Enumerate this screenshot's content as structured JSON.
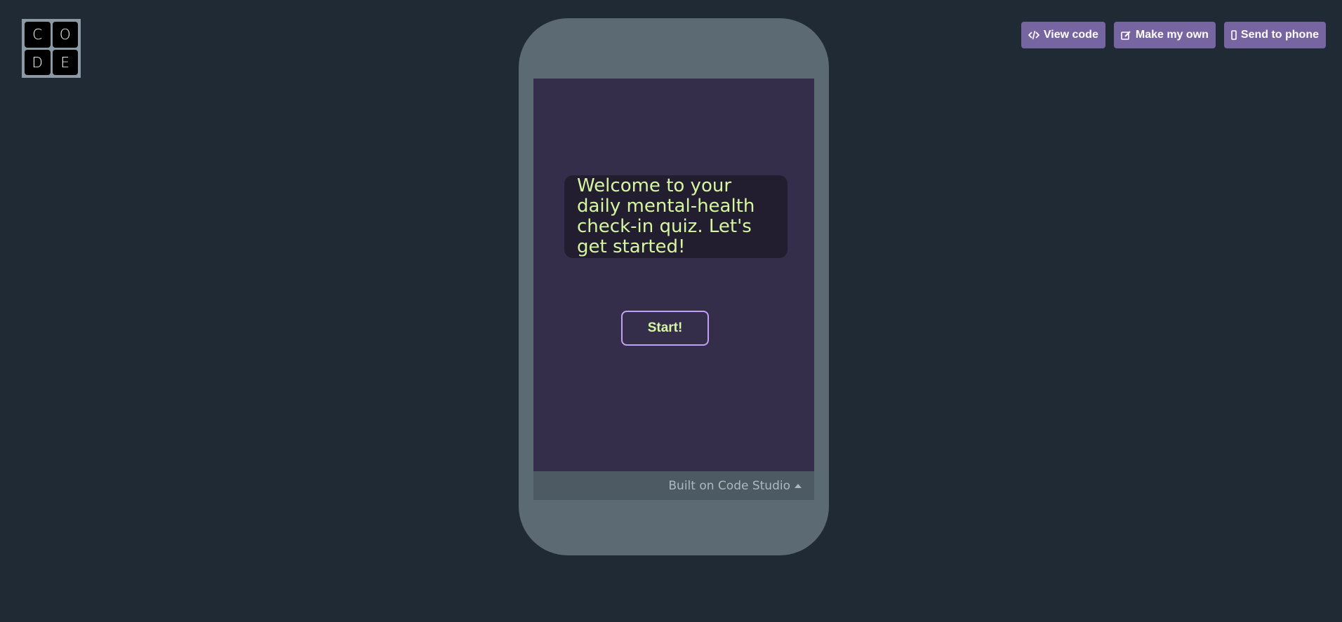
{
  "logo": {
    "letters": [
      "C",
      "O",
      "D",
      "E"
    ]
  },
  "toolbar": {
    "view_code": {
      "icon": "code-icon",
      "label": "View code"
    },
    "make_my_own": {
      "icon": "edit-icon",
      "label": "Make my own"
    },
    "send_to_phone": {
      "icon": "phone-icon",
      "label": "Send to phone"
    }
  },
  "app": {
    "welcome_text": "Welcome to your daily mental-health check-in quiz. Let's get started!",
    "start_label": "Start!"
  },
  "footer": {
    "built_on": "Built on Code Studio",
    "icon": "caret-up-icon"
  },
  "colors": {
    "background": "#1f2a34",
    "button_purple": "#7665a0",
    "phone_frame": "#5b6a73",
    "screen": "#352e4a",
    "text_green": "#d6f7a2",
    "start_border": "#c4a0f5"
  }
}
